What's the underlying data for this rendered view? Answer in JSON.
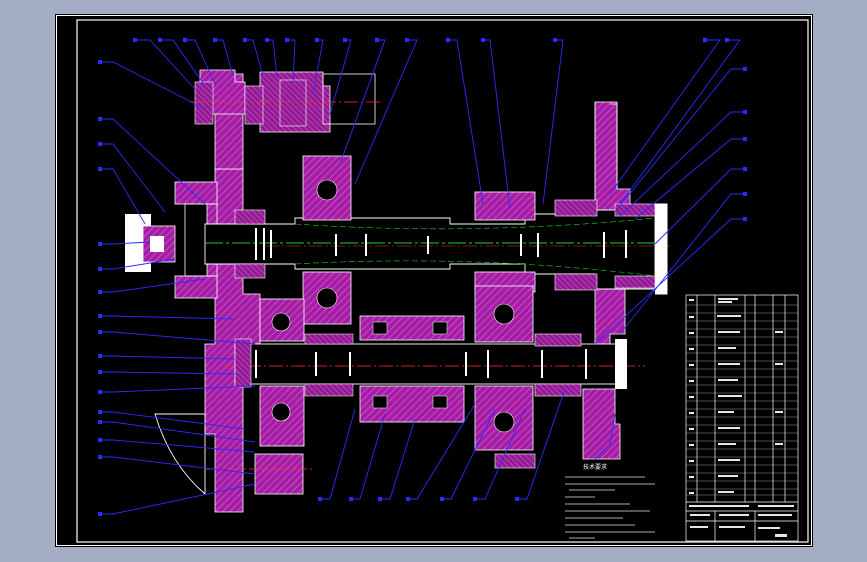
{
  "drawing": {
    "kind": "gearbox assembly cad drawing",
    "colors": {
      "background": "#a3aec5",
      "sheet": "#000000",
      "border": "#ffffff",
      "hatch": "#c02bc0",
      "part_outline": "#ffffff",
      "leader": "#2b2bff",
      "centerline": "#ff3030",
      "shaft_centerline": "#20d020"
    }
  },
  "notes": {
    "title": "技术要求"
  }
}
